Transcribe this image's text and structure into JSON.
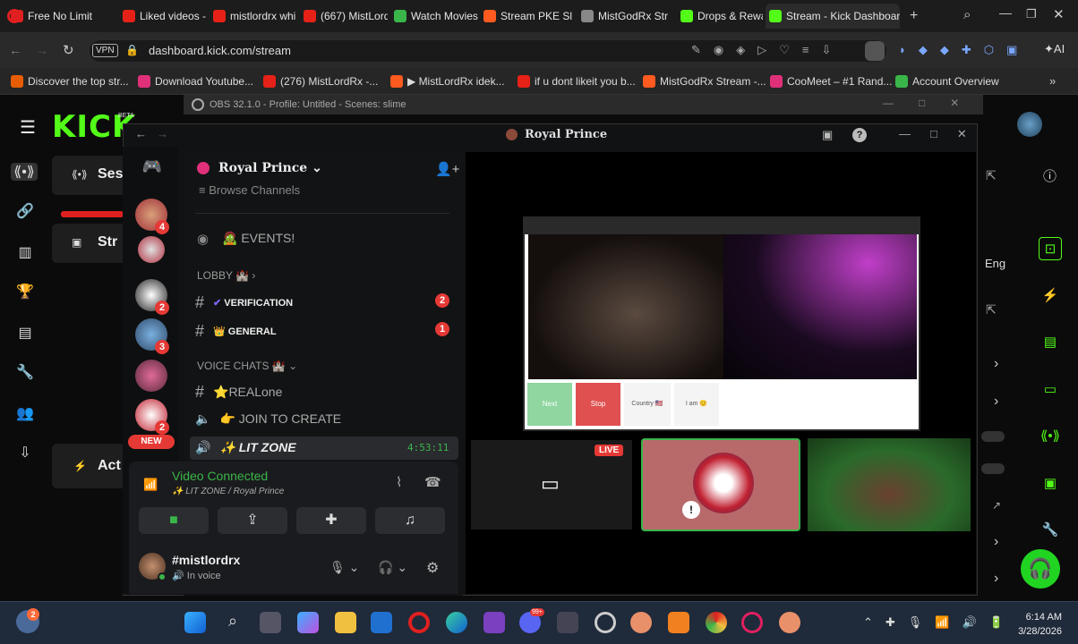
{
  "browser": {
    "tabs": [
      {
        "label": "Free No Limit",
        "icon": "opera-icon",
        "color": "#e02020"
      },
      {
        "label": "Liked videos -",
        "icon": "youtube-icon",
        "color": "#e62117"
      },
      {
        "label": "mistlordrx whi",
        "icon": "youtube-icon",
        "color": "#e62117"
      },
      {
        "label": "(667) MistLord",
        "icon": "youtube-icon",
        "color": "#e62117"
      },
      {
        "label": "Watch Movies",
        "icon": "play-icon",
        "color": "#3ab54a"
      },
      {
        "label": "Stream PKE Sl",
        "icon": "stream-icon",
        "color": "#ff5a1f"
      },
      {
        "label": "MistGodRx Str",
        "icon": "loading-icon",
        "color": "#888888"
      },
      {
        "label": "Drops & Rewa",
        "icon": "kick-icon",
        "color": "#53fc18"
      },
      {
        "label": "Stream - Kick Dashboard",
        "icon": "kick-icon",
        "color": "#53fc18"
      }
    ],
    "url": "dashboard.kick.com/stream",
    "vpn_label": "VPN",
    "ai_label": "AI",
    "bookmarks": [
      {
        "label": "Discover the top str...",
        "color": "#e85d04"
      },
      {
        "label": "Download Youtube...",
        "color": "#e0307a"
      },
      {
        "label": "(276) MistLordRx -...",
        "color": "#e62117"
      },
      {
        "label": "▶ MistLordRx idek...",
        "color": "#ff5a1f"
      },
      {
        "label": "if u dont likeit you b...",
        "color": "#e62117"
      },
      {
        "label": "MistGodRx Stream -...",
        "color": "#ff5a1f"
      },
      {
        "label": "CooMeet – #1 Rand...",
        "color": "#e0307a"
      },
      {
        "label": "Account Overview",
        "color": "#3ab54a"
      }
    ]
  },
  "kick": {
    "logo": "KICK",
    "beta": "BETA",
    "session_label": "Ses",
    "stream_label": "Str",
    "activity_label": "Act",
    "lang_label": "Eng"
  },
  "obs": {
    "title": "OBS 32.1.0 - Profile: Untitled - Scenes: slime"
  },
  "discord": {
    "window_title": "Royal Prince",
    "server_name": "Royal Prince",
    "browse_channels": "Browse Channels",
    "new_badge": "NEW",
    "events": "🧟 EVENTS!",
    "lobby": "LOBBY 🏰",
    "voice_chats": "VOICE CHATS 🏰",
    "channels": [
      {
        "label": "VERIFICATION",
        "prefix": "✔",
        "badge": "2"
      },
      {
        "label": "GENERAL",
        "prefix": "👑",
        "badge": "1"
      }
    ],
    "voice_channels": [
      {
        "label": "⭐REALone"
      },
      {
        "label": "👉 JOIN TO CREATE"
      },
      {
        "label": "✨ LIT ZONE",
        "timer": "4:53:11"
      }
    ],
    "voice_status": "Video Connected",
    "voice_location": "✨ LIT ZONE / Royal Prince",
    "username": "#mistlordrx",
    "user_status": "In voice",
    "server_badges": [
      "4",
      "2",
      "3",
      "2"
    ],
    "live_badge": "LIVE",
    "screen": {
      "next": "Next",
      "stop": "Stop",
      "country": "Country 🇺🇸",
      "iam": "I am 😊"
    }
  },
  "taskbar": {
    "time": "6:14 AM",
    "date": "3/28/2026",
    "notif_badge": "2",
    "discord_badge": "99+"
  }
}
